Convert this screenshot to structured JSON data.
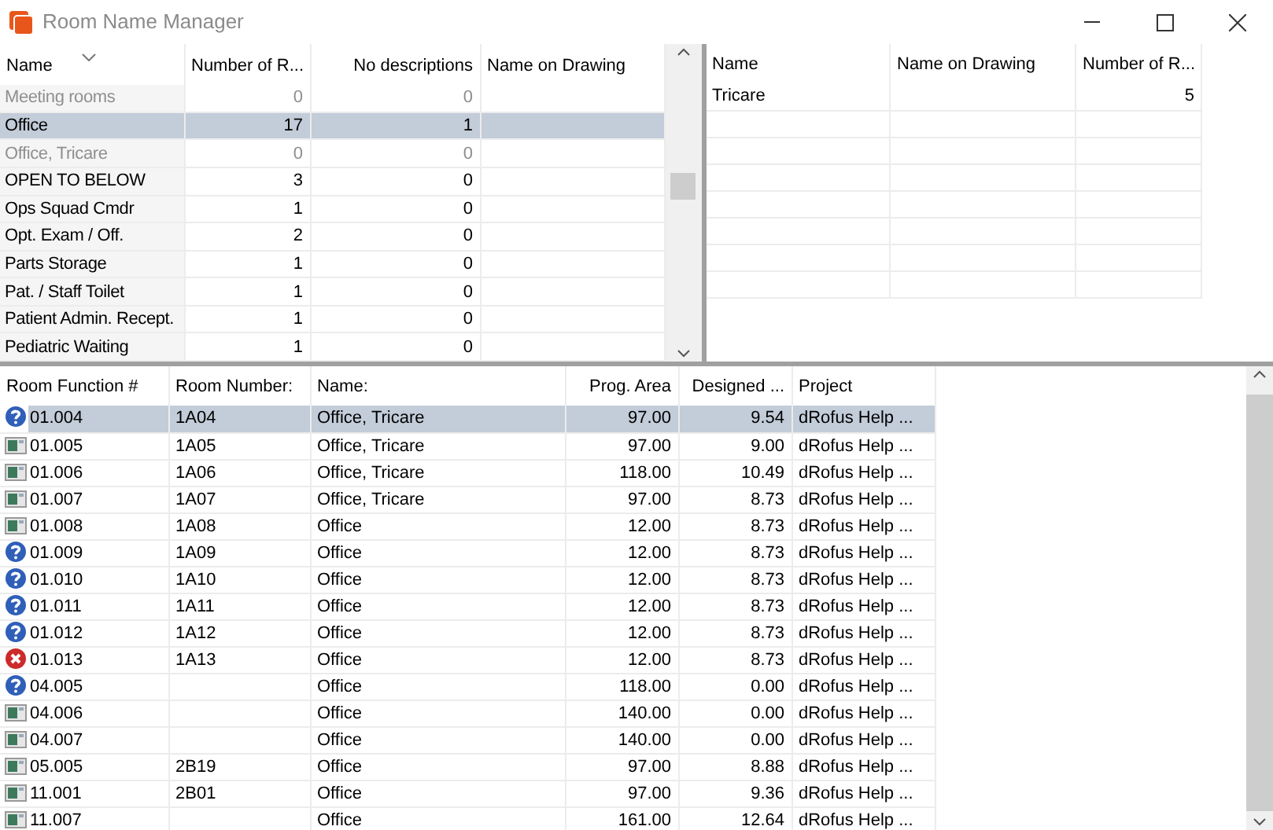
{
  "window": {
    "title": "Room Name Manager"
  },
  "names_table": {
    "columns": [
      "Name",
      "Number of R...",
      "No descriptions",
      "Name on Drawing"
    ],
    "rows": [
      {
        "cells": [
          "Meeting rooms",
          "0",
          "0",
          ""
        ],
        "dimmed": true,
        "selected": false
      },
      {
        "cells": [
          "Office",
          "17",
          "1",
          ""
        ],
        "dimmed": false,
        "selected": true
      },
      {
        "cells": [
          "Office, Tricare",
          "0",
          "0",
          ""
        ],
        "dimmed": true,
        "selected": false
      },
      {
        "cells": [
          "OPEN TO BELOW",
          "3",
          "0",
          ""
        ],
        "dimmed": false,
        "selected": false
      },
      {
        "cells": [
          "Ops Squad Cmdr",
          "1",
          "0",
          ""
        ],
        "dimmed": false,
        "selected": false
      },
      {
        "cells": [
          "Opt. Exam / Off.",
          "2",
          "0",
          ""
        ],
        "dimmed": false,
        "selected": false
      },
      {
        "cells": [
          "Parts Storage",
          "1",
          "0",
          ""
        ],
        "dimmed": false,
        "selected": false
      },
      {
        "cells": [
          "Pat. / Staff Toilet",
          "1",
          "0",
          ""
        ],
        "dimmed": false,
        "selected": false
      },
      {
        "cells": [
          "Patient Admin. Recept.",
          "1",
          "0",
          ""
        ],
        "dimmed": false,
        "selected": false
      },
      {
        "cells": [
          "Pediatric Waiting",
          "1",
          "0",
          ""
        ],
        "dimmed": false,
        "selected": false
      }
    ]
  },
  "sub_table": {
    "columns": [
      "Name",
      "Name on Drawing",
      "Number of R..."
    ],
    "rows": [
      {
        "cells": [
          "Tricare",
          "",
          "5"
        ]
      }
    ]
  },
  "rooms_table": {
    "columns": [
      "Room Function #",
      "Room Number:",
      "Name:",
      "Prog. Area",
      "Designed ...",
      "Project"
    ],
    "rows": [
      {
        "kind": "question",
        "selected": true,
        "cells": [
          "01.004",
          "1A04",
          "Office, Tricare",
          "97.00",
          "9.54",
          "dRofus Help ..."
        ]
      },
      {
        "kind": "room",
        "selected": false,
        "cells": [
          "01.005",
          "1A05",
          "Office, Tricare",
          "97.00",
          "9.00",
          "dRofus Help ..."
        ]
      },
      {
        "kind": "room",
        "selected": false,
        "cells": [
          "01.006",
          "1A06",
          "Office, Tricare",
          "118.00",
          "10.49",
          "dRofus Help ..."
        ]
      },
      {
        "kind": "room",
        "selected": false,
        "cells": [
          "01.007",
          "1A07",
          "Office, Tricare",
          "97.00",
          "8.73",
          "dRofus Help ..."
        ]
      },
      {
        "kind": "room",
        "selected": false,
        "cells": [
          "01.008",
          "1A08",
          "Office",
          "12.00",
          "8.73",
          "dRofus Help ..."
        ]
      },
      {
        "kind": "question",
        "selected": false,
        "cells": [
          "01.009",
          "1A09",
          "Office",
          "12.00",
          "8.73",
          "dRofus Help ..."
        ]
      },
      {
        "kind": "question",
        "selected": false,
        "cells": [
          "01.010",
          "1A10",
          "Office",
          "12.00",
          "8.73",
          "dRofus Help ..."
        ]
      },
      {
        "kind": "question",
        "selected": false,
        "cells": [
          "01.011",
          "1A11",
          "Office",
          "12.00",
          "8.73",
          "dRofus Help ..."
        ]
      },
      {
        "kind": "question",
        "selected": false,
        "cells": [
          "01.012",
          "1A12",
          "Office",
          "12.00",
          "8.73",
          "dRofus Help ..."
        ]
      },
      {
        "kind": "error",
        "selected": false,
        "cells": [
          "01.013",
          "1A13",
          "Office",
          "12.00",
          "8.73",
          "dRofus Help ..."
        ]
      },
      {
        "kind": "question",
        "selected": false,
        "cells": [
          "04.005",
          "",
          "Office",
          "118.00",
          "0.00",
          "dRofus Help ..."
        ]
      },
      {
        "kind": "room",
        "selected": false,
        "cells": [
          "04.006",
          "",
          "Office",
          "140.00",
          "0.00",
          "dRofus Help ..."
        ]
      },
      {
        "kind": "room",
        "selected": false,
        "cells": [
          "04.007",
          "",
          "Office",
          "140.00",
          "0.00",
          "dRofus Help ..."
        ]
      },
      {
        "kind": "room",
        "selected": false,
        "cells": [
          "05.005",
          "2B19",
          "Office",
          "97.00",
          "8.88",
          "dRofus Help ..."
        ]
      },
      {
        "kind": "room",
        "selected": false,
        "cells": [
          "11.001",
          "2B01",
          "Office",
          "97.00",
          "9.36",
          "dRofus Help ..."
        ]
      },
      {
        "kind": "room",
        "selected": false,
        "cells": [
          "11.007",
          "",
          "Office",
          "161.00",
          "12.64",
          "dRofus Help ..."
        ]
      }
    ]
  }
}
